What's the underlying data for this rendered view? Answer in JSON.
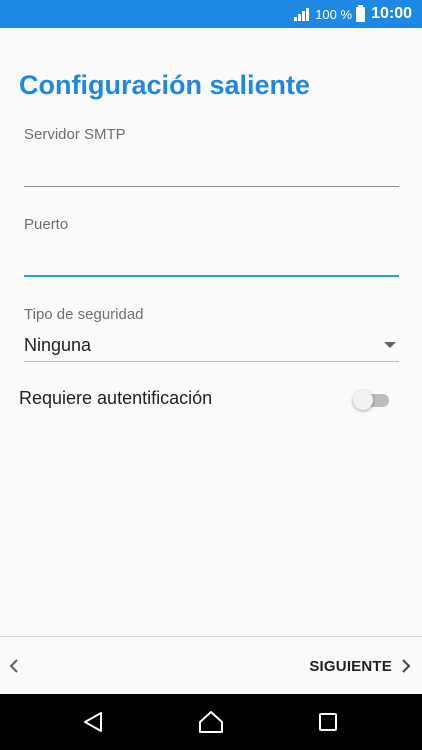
{
  "status_bar": {
    "battery_percent": "100 %",
    "time": "10:00",
    "icons": [
      "signal-icon",
      "battery-icon"
    ]
  },
  "screen": {
    "title": "Configuración saliente"
  },
  "fields": {
    "smtp_server": {
      "label": "Servidor SMTP",
      "value": "",
      "placeholder": ""
    },
    "port": {
      "label": "Puerto",
      "value": "",
      "placeholder": ""
    },
    "security": {
      "label": "Tipo de seguridad",
      "selected": "Ninguna"
    }
  },
  "auth_toggle": {
    "label": "Requiere autentificación",
    "checked": false
  },
  "bottom_bar": {
    "next_label": "SIGUIENTE"
  },
  "colors": {
    "accent": "#1e88e5",
    "focus_underline": "#26a7c6",
    "background": "#fafafa",
    "nav_bar": "#000000"
  }
}
